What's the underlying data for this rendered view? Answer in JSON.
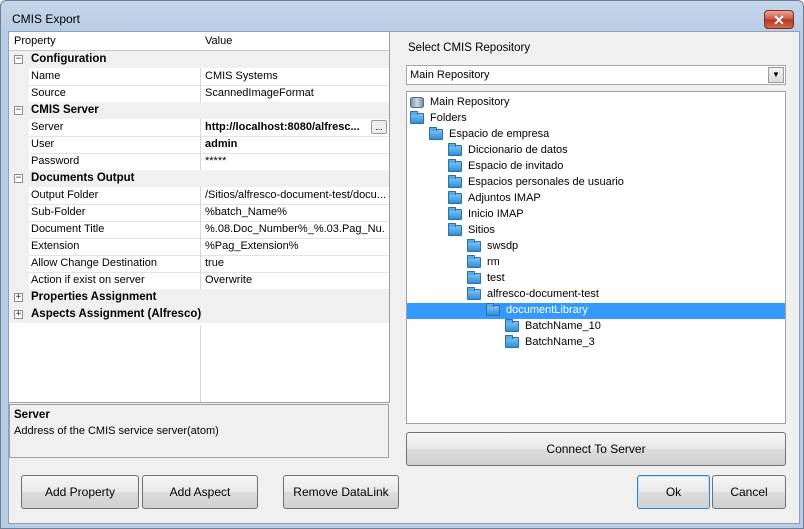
{
  "window": {
    "title": "CMIS Export",
    "close_glyph": "✕"
  },
  "grid": {
    "col_property": "Property",
    "col_value": "Value",
    "rows": [
      {
        "kind": "cat",
        "label": "Configuration",
        "toggle": "−"
      },
      {
        "kind": "prop",
        "key": "Name",
        "value": "CMIS Systems"
      },
      {
        "kind": "prop",
        "key": "Source",
        "value": "ScannedImageFormat"
      },
      {
        "kind": "cat",
        "label": "CMIS Server",
        "toggle": "−"
      },
      {
        "kind": "prop",
        "key": "Server",
        "value": "http://localhost:8080/alfresc...",
        "bold": true,
        "ellipsis": "..."
      },
      {
        "kind": "prop",
        "key": "User",
        "value": "admin",
        "bold": true
      },
      {
        "kind": "prop",
        "key": "Password",
        "value": "*****"
      },
      {
        "kind": "cat",
        "label": "Documents Output",
        "toggle": "−"
      },
      {
        "kind": "prop",
        "key": "Output Folder",
        "value": "/Sitios/alfresco-document-test/docu..."
      },
      {
        "kind": "prop",
        "key": "Sub-Folder",
        "value": "%batch_Name%"
      },
      {
        "kind": "prop",
        "key": "Document Title",
        "value": "%.08.Doc_Number%_%.03.Pag_Nu..."
      },
      {
        "kind": "prop",
        "key": "Extension",
        "value": "%Pag_Extension%"
      },
      {
        "kind": "prop",
        "key": "Allow Change Destination",
        "value": "true"
      },
      {
        "kind": "prop",
        "key": "Action if exist on server",
        "value": "Overwrite"
      },
      {
        "kind": "cat",
        "label": "Properties Assignment",
        "toggle": "+"
      },
      {
        "kind": "cat",
        "label": "Aspects Assignment (Alfresco)",
        "toggle": "+"
      }
    ]
  },
  "description": {
    "title": "Server",
    "text": "Address of the CMIS service server(atom)"
  },
  "buttons": {
    "add_property": "Add Property",
    "add_aspect": "Add Aspect",
    "remove_datalink": "Remove DataLink",
    "connect": "Connect To Server",
    "ok": "Ok",
    "cancel": "Cancel"
  },
  "repo": {
    "label": "Select CMIS Repository",
    "selected": "Main Repository",
    "arrow": "▼"
  },
  "tree": [
    {
      "label": "Main Repository",
      "depth": 0,
      "icon": "database-icon"
    },
    {
      "label": "Folders",
      "depth": 0,
      "icon": "folder-icon"
    },
    {
      "label": "Espacio de empresa",
      "depth": 1,
      "icon": "folder-icon"
    },
    {
      "label": "Diccionario de datos",
      "depth": 2,
      "icon": "folder-icon"
    },
    {
      "label": "Espacio de invitado",
      "depth": 2,
      "icon": "folder-icon"
    },
    {
      "label": "Espacios personales de usuario",
      "depth": 2,
      "icon": "folder-icon"
    },
    {
      "label": "Adjuntos IMAP",
      "depth": 2,
      "icon": "folder-icon"
    },
    {
      "label": "Inicio IMAP",
      "depth": 2,
      "icon": "folder-icon"
    },
    {
      "label": "Sitios",
      "depth": 2,
      "icon": "folder-icon"
    },
    {
      "label": "swsdp",
      "depth": 3,
      "icon": "folder-icon"
    },
    {
      "label": "rm",
      "depth": 3,
      "icon": "folder-icon"
    },
    {
      "label": "test",
      "depth": 3,
      "icon": "folder-icon"
    },
    {
      "label": "alfresco-document-test",
      "depth": 3,
      "icon": "folder-icon"
    },
    {
      "label": "documentLibrary",
      "depth": 4,
      "icon": "folder-icon",
      "selected": true
    },
    {
      "label": "BatchName_10",
      "depth": 5,
      "icon": "folder-icon"
    },
    {
      "label": "BatchName_3",
      "depth": 5,
      "icon": "folder-icon"
    }
  ],
  "colors": {
    "selection": "#3399ff",
    "window_frame": "#b9cde4",
    "close_button": "#c95443"
  }
}
